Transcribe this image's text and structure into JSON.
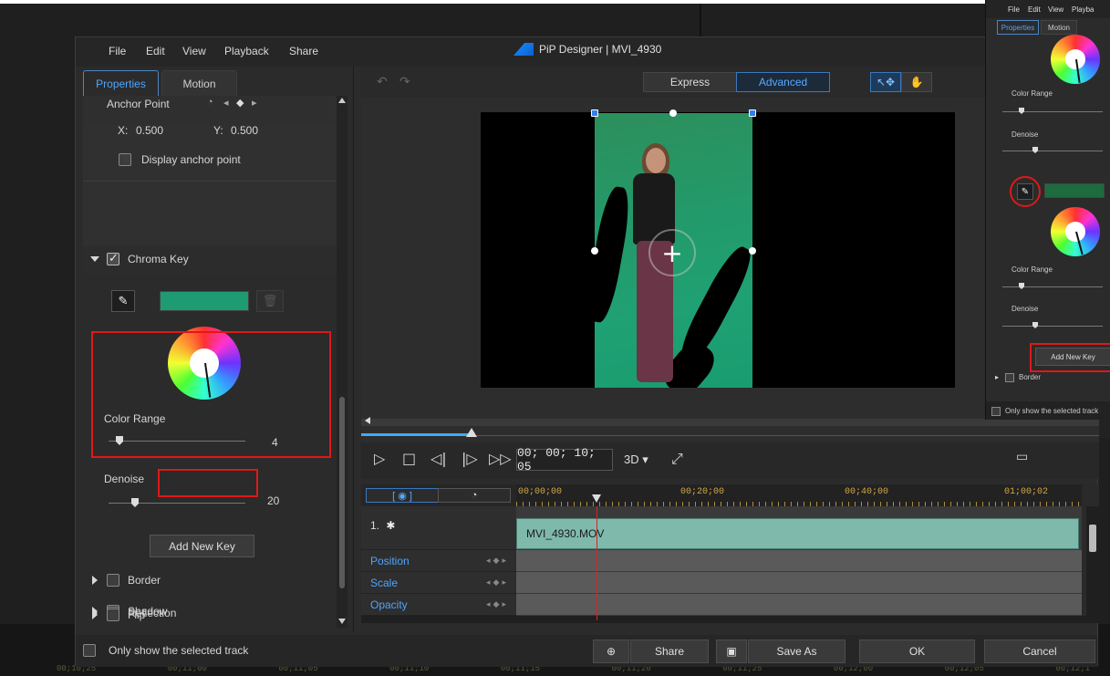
{
  "window": {
    "title": "PiP Designer | MVI_4930"
  },
  "menu": [
    "File",
    "Edit",
    "View",
    "Playback",
    "Share"
  ],
  "tabs": {
    "properties": "Properties",
    "motion": "Motion"
  },
  "anchor": {
    "label": "Anchor Point",
    "x_label": "X:",
    "x_value": "0.500",
    "y_label": "Y:",
    "y_value": "0.500",
    "display_label": "Display anchor point"
  },
  "chroma": {
    "label": "Chroma Key",
    "color": "#1e9b73",
    "color_range_label": "Color Range",
    "color_range_value": "4",
    "denoise_label": "Denoise",
    "denoise_value": "20",
    "add_key_label": "Add New Key"
  },
  "sections": [
    "Border",
    "Shadow",
    "Reflection",
    "Flip"
  ],
  "only_selected_label": "Only show the selected track",
  "preview": {
    "mode_express": "Express",
    "mode_advanced": "Advanced",
    "timecode": "00; 00; 10; 05",
    "three_d": "3D ▾"
  },
  "timeline": {
    "ruler": [
      "00;00;00",
      "00;20;00",
      "00;40;00",
      "01;00;02"
    ],
    "track_name": "1.",
    "clip_name": "MVI_4930.MOV",
    "properties": [
      "Position",
      "Scale",
      "Opacity"
    ]
  },
  "footer": {
    "share": "Share",
    "save_as": "Save As",
    "ok": "OK",
    "cancel": "Cancel"
  },
  "inset": {
    "menu": [
      "File",
      "Edit",
      "View",
      "Playba"
    ],
    "tab_properties": "Properties",
    "tab_motion": "Motion",
    "color_range": "Color Range",
    "denoise": "Denoise",
    "color_range_2": "Color Range",
    "denoise_2": "Denoise",
    "add_key": "Add New Key",
    "border": "Border",
    "only_selected": "Only show the selected track"
  },
  "bg_ruler": [
    "00;10;25",
    "00;11;00",
    "00;11;05",
    "00;11;10",
    "00;11;15",
    "00;11;20",
    "00;11;25",
    "00;12;00",
    "00;12;05",
    "00;12;1"
  ],
  "colors": {
    "accent": "#3daaff",
    "highlight": "#e01818",
    "key_color": "#1e9b73"
  }
}
